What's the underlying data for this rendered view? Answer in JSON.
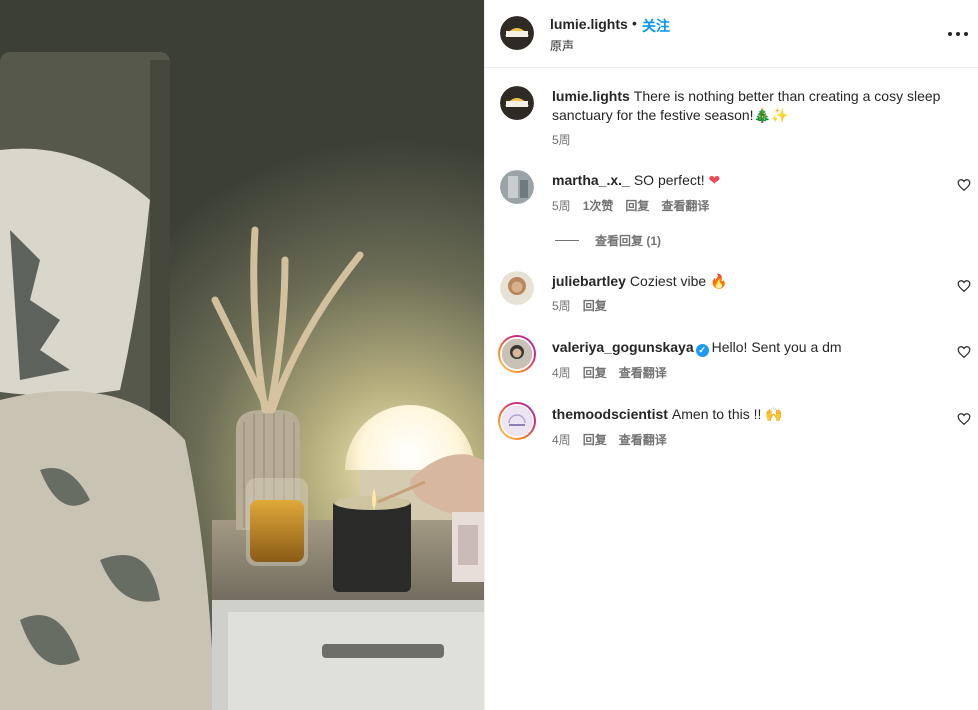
{
  "post": {
    "author": "lumie.lights",
    "separator": "•",
    "follow_label": "关注",
    "audio_label": "原声",
    "caption": "There is nothing better than creating a cosy sleep sanctuary for the festive season!",
    "caption_emoji": "🎄✨",
    "caption_time": "5周"
  },
  "comments": [
    {
      "user": "martha_.x._",
      "text": "SO perfect!",
      "emoji": "❤",
      "time": "5周",
      "likes": "1次赞",
      "reply": "回复",
      "translate": "查看翻译",
      "view_replies": "查看回复 (1)"
    },
    {
      "user": "juliebartley",
      "text": "Coziest vibe",
      "emoji": "🔥",
      "time": "5周",
      "reply": "回复"
    },
    {
      "user": "valeriya_gogunskaya",
      "verified": "✓",
      "text": "Hello! Sent you a dm",
      "time": "4周",
      "reply": "回复",
      "translate": "查看翻译"
    },
    {
      "user": "themoodscientist",
      "text": "Amen to this !!",
      "emoji": "🙌",
      "time": "4周",
      "reply": "回复",
      "translate": "查看翻译"
    }
  ],
  "colors": {
    "link": "#0095f6",
    "secondary": "#737373",
    "text": "#262626",
    "heart": "#ed4956"
  },
  "icons": [
    "more-options-icon",
    "heart-outline-icon",
    "verified-badge-icon",
    "avatar-logo-icon"
  ]
}
